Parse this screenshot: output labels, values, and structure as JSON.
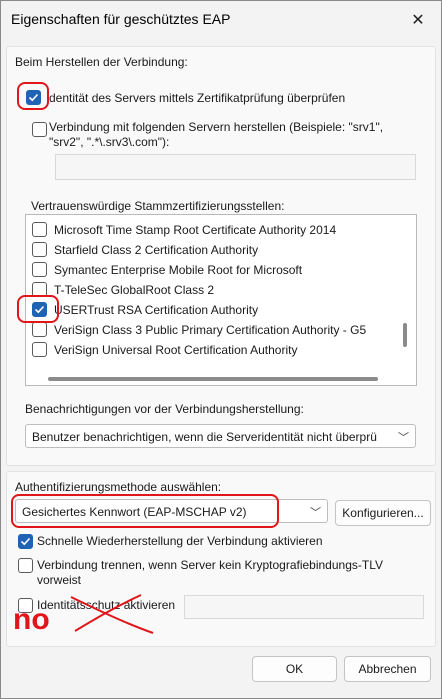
{
  "window": {
    "title": "Eigenschaften für geschütztes EAP"
  },
  "connect_section": {
    "header": "Beim Herstellen der Verbindung:",
    "verify_identity": {
      "label": "dentität des Servers mittels Zertifikatprüfung überprüfen",
      "checked": true
    },
    "connect_servers": {
      "label_line1": "Verbindung mit folgenden Servern herstellen (Beispiele: \"srv1\",",
      "label_line2": "\"srv2\", \".*\\.srv3\\.com\"):",
      "checked": false,
      "value": ""
    }
  },
  "root_ca": {
    "header": "Vertrauenswürdige Stammzertifizierungsstellen:",
    "items": [
      {
        "label": "Microsoft Time Stamp Root Certificate Authority 2014",
        "checked": false
      },
      {
        "label": "Starfield Class 2 Certification Authority",
        "checked": false
      },
      {
        "label": "Symantec Enterprise Mobile Root for Microsoft",
        "checked": false
      },
      {
        "label": "T-TeleSec GlobalRoot Class 2",
        "checked": false
      },
      {
        "label": "USERTrust RSA Certification Authority",
        "checked": true
      },
      {
        "label": "VeriSign Class 3 Public Primary Certification Authority - G5",
        "checked": false
      },
      {
        "label": "VeriSign Universal Root Certification Authority",
        "checked": false
      }
    ]
  },
  "notifications": {
    "header": "Benachrichtigungen vor der Verbindungsherstellung:",
    "selected": "Benutzer benachrichtigen, wenn die Serveridentität nicht überprü"
  },
  "auth": {
    "header": "Authentifizierungsmethode auswählen:",
    "selected": "Gesichertes Kennwort (EAP-MSCHAP v2)",
    "configure_label": "Konfigurieren..."
  },
  "options": {
    "fast_reconnect": {
      "label": "Schnelle Wiederherstellung der Verbindung aktivieren",
      "checked": true
    },
    "disconnect_tlv": {
      "label_line1": "Verbindung trennen, wenn Server kein Kryptografiebindungs-TLV",
      "label_line2": "vorweist",
      "checked": false
    },
    "identity_privacy": {
      "label": "Identitätsschutz aktivieren",
      "checked": false,
      "value": ""
    }
  },
  "annotation": {
    "text": "no",
    "color": "#e0161b"
  },
  "buttons": {
    "ok": "OK",
    "cancel": "Abbrechen"
  },
  "colors": {
    "accent": "#1f63b5",
    "annotation_red": "#e0161b"
  }
}
